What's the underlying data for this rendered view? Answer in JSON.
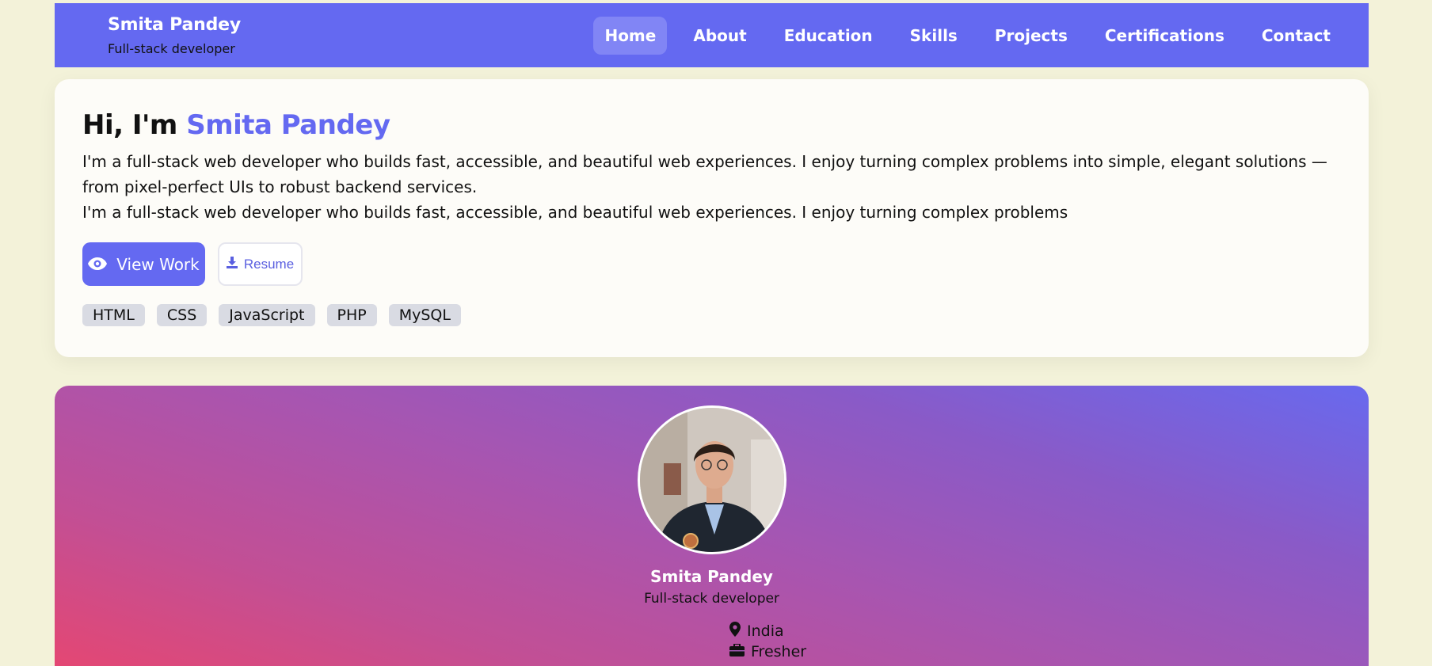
{
  "brand": {
    "name": "Smita Pandey",
    "subtitle": "Full-stack developer"
  },
  "nav": {
    "items": [
      {
        "label": "Home",
        "active": true
      },
      {
        "label": "About"
      },
      {
        "label": "Education"
      },
      {
        "label": "Skills"
      },
      {
        "label": "Projects"
      },
      {
        "label": "Certifications"
      },
      {
        "label": "Contact"
      }
    ]
  },
  "hero": {
    "greeting": "Hi, I'm",
    "name": "Smita Pandey",
    "paragraph1": "I'm a full-stack web developer who builds fast, accessible, and beautiful web experiences. I enjoy turning complex problems into simple, elegant solutions — from pixel-perfect UIs to robust backend services.",
    "paragraph2": "I'm a full-stack web developer who builds fast, accessible, and beautiful web experiences. I enjoy turning complex problems",
    "view_work_label": "View Work",
    "resume_label": "Resume",
    "tags": [
      "HTML",
      "CSS",
      "JavaScript",
      "PHP",
      "MySQL"
    ]
  },
  "profile": {
    "name": "Smita Pandey",
    "role": "Full-stack developer",
    "location": "India",
    "experience": "Fresher"
  },
  "colors": {
    "accent": "#6469f1",
    "background": "#f3f2d9",
    "gradient_start": "#e8466f",
    "gradient_end": "#6869ee"
  },
  "icons": {
    "view_work": "eye-icon",
    "resume": "download-icon",
    "location": "map-pin-icon",
    "experience": "briefcase-icon"
  }
}
